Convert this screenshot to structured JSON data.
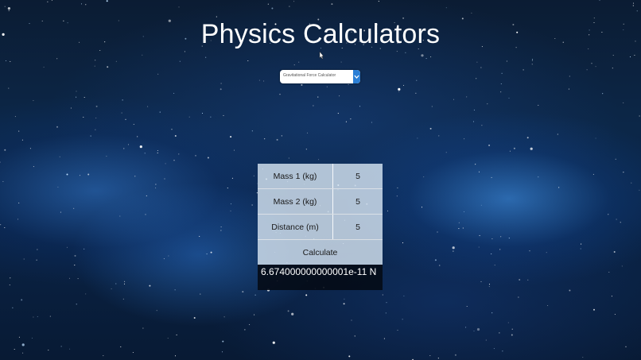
{
  "page": {
    "title": "Physics Calculators"
  },
  "selector": {
    "selected": "Gravitational Force Calculator",
    "accent_color": "#2b7fd6"
  },
  "calculator": {
    "fields": [
      {
        "label": "Mass 1 (kg)",
        "value": "5"
      },
      {
        "label": "Mass 2 (kg)",
        "value": "5"
      },
      {
        "label": "Distance (m)",
        "value": "5"
      }
    ],
    "calculate_label": "Calculate",
    "result": "6.674000000000001e-11 N"
  },
  "icons": {
    "cursor": "mouse-pointer-icon",
    "dropdown": "chevron-down-icon"
  }
}
